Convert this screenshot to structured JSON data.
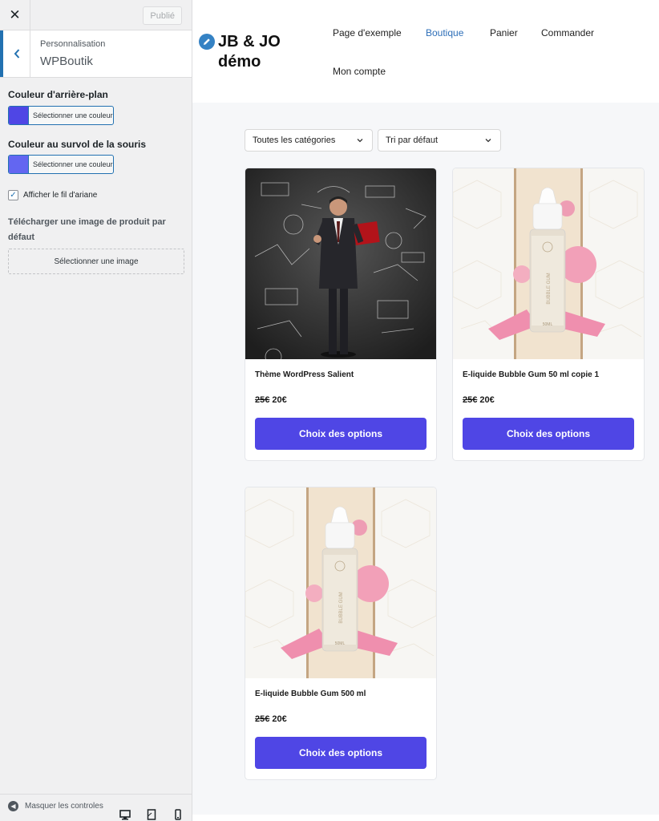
{
  "customizer": {
    "close_glyph": "✕",
    "publish_label": "Publié",
    "back_glyph": "‹",
    "section_subtitle": "Personnalisation",
    "section_title": "WPBoutik",
    "bg_color": {
      "label": "Couleur d'arrière-plan",
      "button_text": "Sélectionner une couleur",
      "swatch": "#4f46e5"
    },
    "hover_color": {
      "label": "Couleur au survol de la souris",
      "button_text": "Sélectionner une couleur",
      "swatch": "#6366f1"
    },
    "breadcrumb": {
      "label": "Afficher le fil d'ariane",
      "checked": true,
      "check_glyph": "✓"
    },
    "default_image": {
      "label": "Télécharger une image de produit par défaut",
      "button": "Sélectionner une image"
    },
    "footer": {
      "hide_label": "Masquer les controles",
      "hide_glyph": "◀",
      "devices": [
        "desktop-icon",
        "tablet-icon",
        "mobile-icon"
      ]
    }
  },
  "site": {
    "logo_line1": "JB & JO",
    "logo_line2": "démo",
    "nav": [
      {
        "label": "Page d'exemple",
        "active": false
      },
      {
        "label": "Boutique",
        "active": true
      },
      {
        "label": "Panier",
        "active": false
      },
      {
        "label": "Commander",
        "active": false
      },
      {
        "label": "Mon compte",
        "active": false
      }
    ],
    "accent": "#2e6fb8"
  },
  "shop": {
    "filters": [
      {
        "label": "Toutes les catégories"
      },
      {
        "label": "Tri par défaut"
      }
    ],
    "button_color": "#4f46e5",
    "products": [
      {
        "title": "Thème WordPress Salient",
        "old_price": "25€",
        "price": "20€",
        "button": "Choix des options",
        "image": "businessman-chalkboard"
      },
      {
        "title": "E-liquide Bubble Gum 50 ml copie 1",
        "old_price": "25€",
        "price": "20€",
        "button": "Choix des options",
        "image": "bubble-gum-bottle"
      },
      {
        "title": "E-liquide Bubble Gum 500 ml",
        "old_price": "25€",
        "price": "20€",
        "button": "Choix des options",
        "image": "bubble-gum-bottle"
      }
    ],
    "bottle_label": "BUBBLE GUM",
    "bottle_volume": "50ML"
  }
}
